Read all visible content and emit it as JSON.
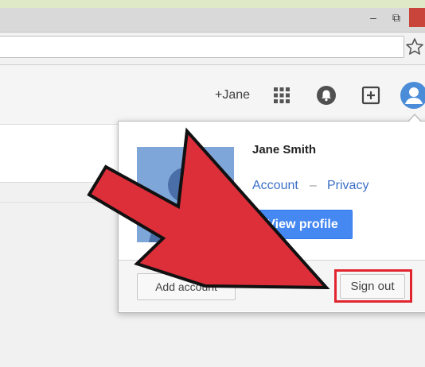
{
  "window": {
    "minimize_glyph": "–",
    "maximize_glyph": "⧉"
  },
  "header": {
    "user_link": "+Jane",
    "icons": [
      "apps-icon",
      "notifications-icon",
      "share-icon",
      "avatar-icon"
    ]
  },
  "account_popup": {
    "name": "Jane Smith",
    "account_link": "Account",
    "separator": "–",
    "privacy_link": "Privacy",
    "view_profile_label": "View profile",
    "add_account_label": "Add account",
    "sign_out_label": "Sign out"
  },
  "annotation": {
    "arrow_color": "#dc2f3a",
    "highlight_color": "#e0252e"
  }
}
